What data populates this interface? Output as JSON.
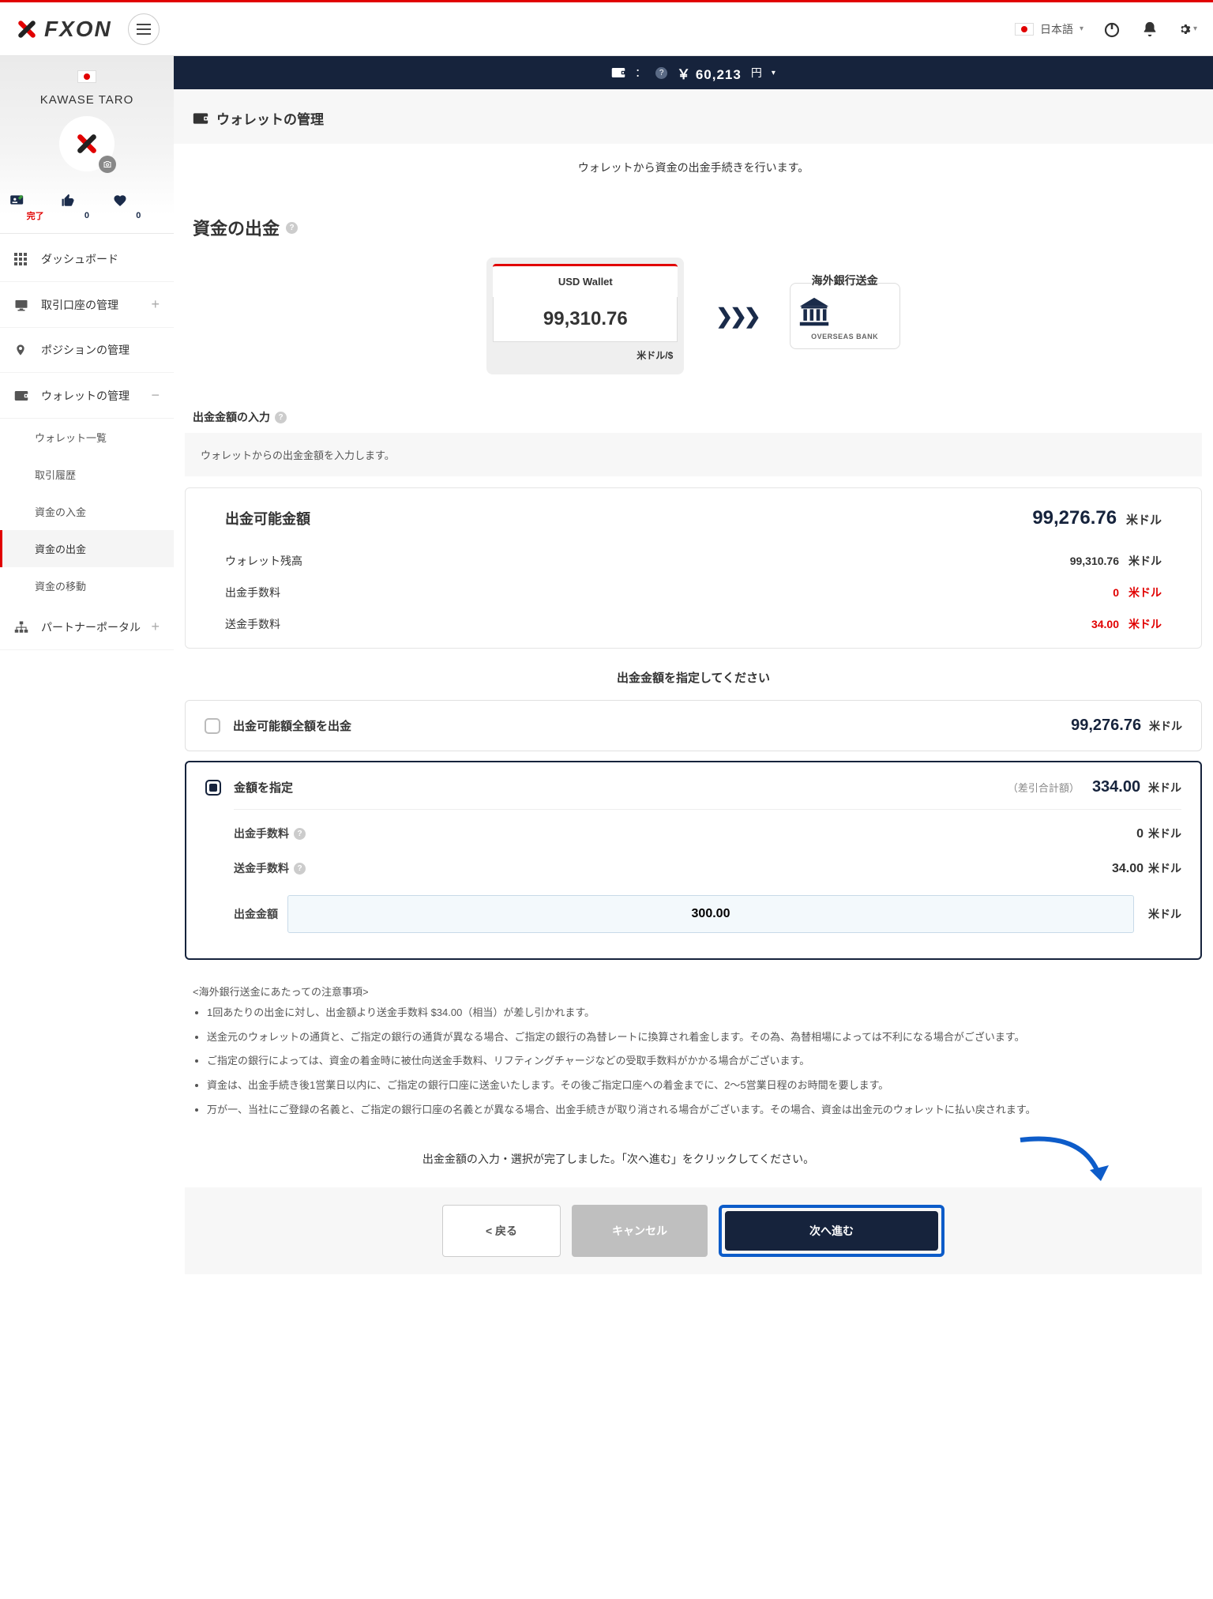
{
  "header": {
    "brand": "FXON",
    "language": "日本語"
  },
  "sidebar": {
    "user_name": "KAWASE TARO",
    "stats": {
      "done_label": "完了",
      "likes": "0",
      "hearts": "0"
    },
    "items": {
      "dashboard": "ダッシュボード",
      "accounts": "取引口座の管理",
      "positions": "ポジションの管理",
      "wallet": "ウォレットの管理",
      "partner": "パートナーポータル"
    },
    "wallet_sub": {
      "list": "ウォレット一覧",
      "history": "取引履歴",
      "deposit": "資金の入金",
      "withdraw": "資金の出金",
      "transfer": "資金の移動"
    }
  },
  "balance_bar": {
    "amount": "￥ 60,213",
    "currency": "円"
  },
  "page": {
    "title": "ウォレットの管理",
    "desc": "ウォレットから資金の出金手続きを行います。",
    "section_title": "資金の出金",
    "wallet": {
      "name": "USD Wallet",
      "balance": "99,310.76",
      "currency": "米ドル/$"
    },
    "bank": {
      "title": "海外銀行送金",
      "label": "OVERSEAS BANK"
    },
    "input_title": "出金金額の入力",
    "input_desc": "ウォレットからの出金金額を入力します。",
    "summary": {
      "available_label": "出金可能金額",
      "available_value": "99,276.76",
      "currency": "米ドル",
      "rows": [
        {
          "label": "ウォレット残高",
          "value": "99,310.76",
          "red": false
        },
        {
          "label": "出金手数料",
          "value": "0",
          "red": true
        },
        {
          "label": "送金手数料",
          "value": "34.00",
          "red": true
        }
      ]
    },
    "prompt": "出金金額を指定してください",
    "option_full": {
      "label": "出金可能額全額を出金",
      "value": "99,276.76",
      "currency": "米ドル"
    },
    "option_specify": {
      "label": "金額を指定",
      "sub": "（差引合計額）",
      "value": "334.00",
      "currency": "米ドル",
      "fee_withdraw": {
        "label": "出金手数料",
        "value": "0",
        "currency": "米ドル"
      },
      "fee_transfer": {
        "label": "送金手数料",
        "value": "34.00",
        "currency": "米ドル"
      },
      "amount_label": "出金金額",
      "amount_value": "300.00",
      "amount_currency": "米ドル"
    },
    "notes_title": "<海外銀行送金にあたっての注意事項>",
    "notes": [
      "1回あたりの出金に対し、出金額より送金手数料 $34.00（相当）が差し引かれます。",
      "送金元のウォレットの通貨と、ご指定の銀行の通貨が異なる場合、ご指定の銀行の為替レートに換算され着金します。その為、為替相場によっては不利になる場合がございます。",
      "ご指定の銀行によっては、資金の着金時に被仕向送金手数料、リフティングチャージなどの受取手数料がかかる場合がございます。",
      "資金は、出金手続き後1営業日以内に、ご指定の銀行口座に送金いたします。その後ご指定口座への着金までに、2〜5営業日程のお時間を要します。",
      "万が一、当社にご登録の名義と、ご指定の銀行口座の名義とが異なる場合、出金手続きが取り消される場合がございます。その場合、資金は出金元のウォレットに払い戻されます。"
    ],
    "final_msg": "出金金額の入力・選択が完了しました。「次へ進む」をクリックしてください。",
    "buttons": {
      "back": "< 戻る",
      "cancel": "キャンセル",
      "next": "次へ進む"
    }
  }
}
